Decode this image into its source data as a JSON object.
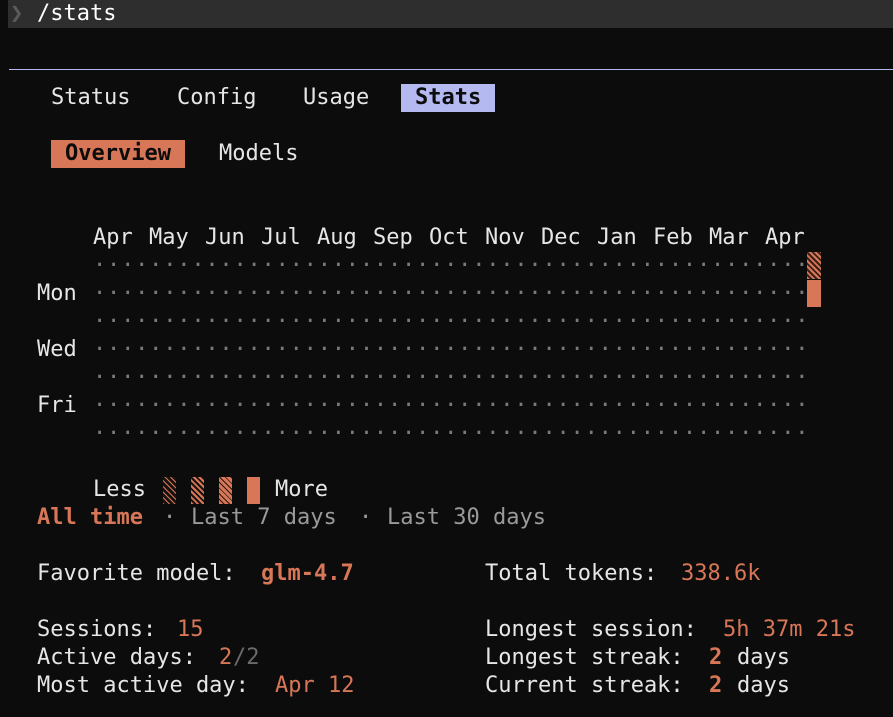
{
  "command": {
    "chevron": "❯",
    "text": "/stats"
  },
  "tabs": [
    {
      "label": "Status"
    },
    {
      "label": "Config"
    },
    {
      "label": "Usage"
    },
    {
      "label": "Stats"
    }
  ],
  "subtabs": [
    {
      "label": "Overview"
    },
    {
      "label": "Models"
    }
  ],
  "heatmap": {
    "months": [
      "Apr",
      "May",
      "Jun",
      "Jul",
      "Aug",
      "Sep",
      "Oct",
      "Nov",
      "Dec",
      "Jan",
      "Feb",
      "Mar",
      "Apr"
    ],
    "day_labels": {
      "mon": "Mon",
      "wed": "Wed",
      "fri": "Fri"
    },
    "legend": {
      "less": "Less",
      "more": "More"
    }
  },
  "range": {
    "all_time": "All time",
    "sep": "·",
    "last7": "Last 7 days",
    "last30": "Last 30 days"
  },
  "stats": {
    "favorite_model_label": "Favorite model:",
    "favorite_model_value": "glm-4.7",
    "total_tokens_label": "Total tokens:",
    "total_tokens_value": "338.6k",
    "sessions_label": "Sessions:",
    "sessions_value": "15",
    "longest_session_label": "Longest session:",
    "longest_session_value": "5h 37m 21s",
    "active_days_label": "Active days:",
    "active_days_value": "2",
    "active_days_total": "/2",
    "longest_streak_label": "Longest streak:",
    "longest_streak_value": "2",
    "longest_streak_unit": "days",
    "most_active_label": "Most active day:",
    "most_active_value": "Apr 12",
    "current_streak_label": "Current streak:",
    "current_streak_value": "2",
    "current_streak_unit": "days"
  },
  "colors": {
    "accent": "#d77757",
    "tab_active": "#b4b9f0",
    "background": "#0c0c0c"
  }
}
